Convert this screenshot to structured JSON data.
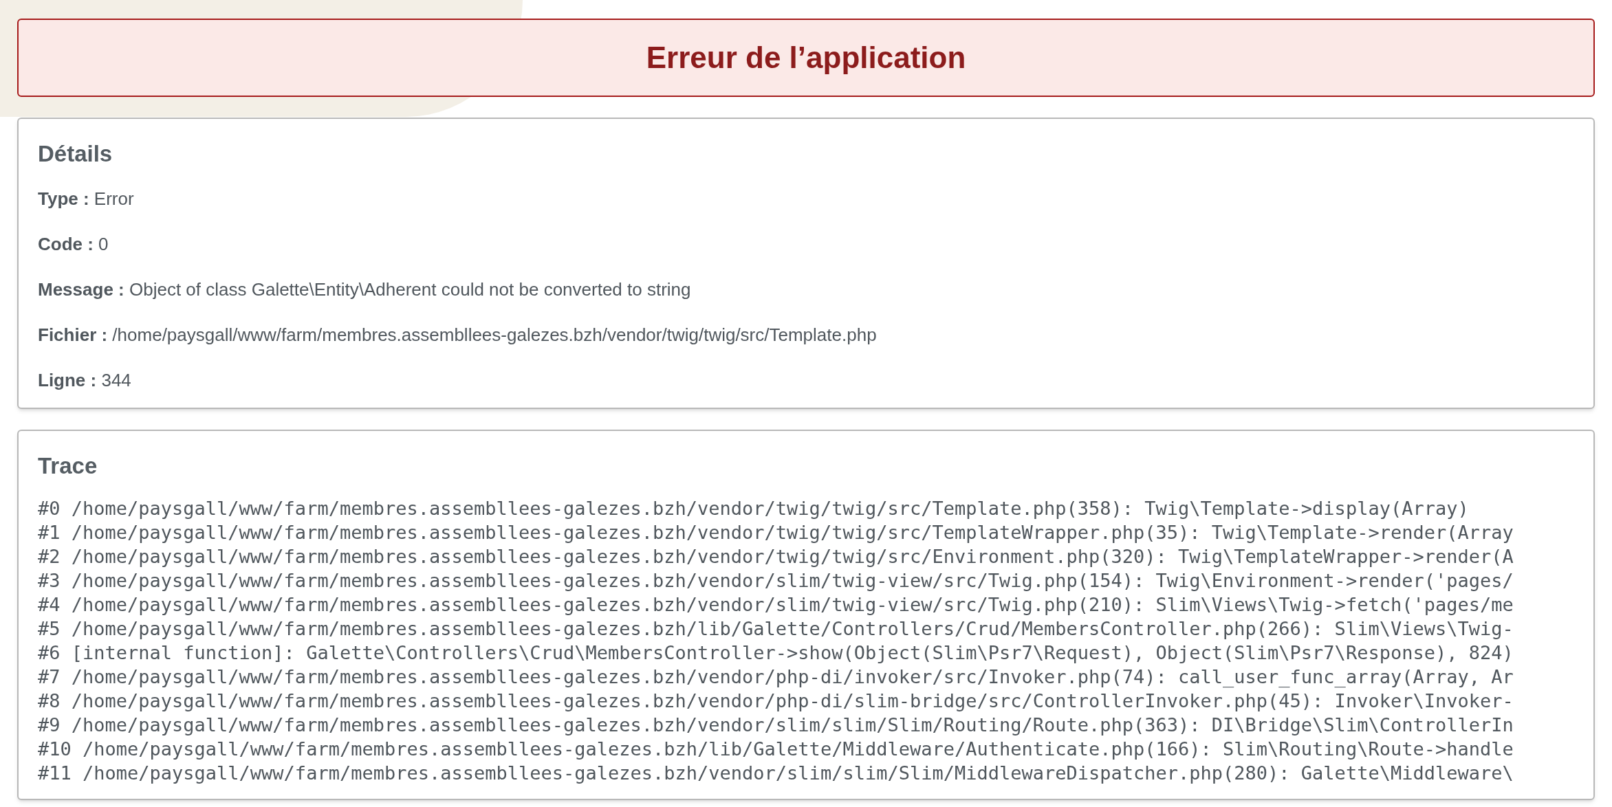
{
  "title": "Erreur de l’application",
  "details": {
    "heading": "Détails",
    "rows": [
      "**Type :** Error",
      "**Code :** 0",
      "**Message :** Object of class Galette\\Entity\\Adherent could not be converted to string",
      "**Fichier :** /home/paysgall/www/farm/membres.assembllees-galezes.bzh/vendor/twig/twig/src/Template.php",
      "**Ligne :** 344"
    ]
  },
  "trace": {
    "heading": "Trace",
    "lines": [
      "#0 /home/paysgall/www/farm/membres.assembllees-galezes.bzh/vendor/twig/twig/src/Template.php(358): Twig\\Template->display(Array)",
      "#1 /home/paysgall/www/farm/membres.assembllees-galezes.bzh/vendor/twig/twig/src/TemplateWrapper.php(35): Twig\\Template->render(Array",
      "#2 /home/paysgall/www/farm/membres.assembllees-galezes.bzh/vendor/twig/twig/src/Environment.php(320): Twig\\TemplateWrapper->render(A",
      "#3 /home/paysgall/www/farm/membres.assembllees-galezes.bzh/vendor/slim/twig-view/src/Twig.php(154): Twig\\Environment->render('pages/",
      "#4 /home/paysgall/www/farm/membres.assembllees-galezes.bzh/vendor/slim/twig-view/src/Twig.php(210): Slim\\Views\\Twig->fetch('pages/me",
      "#5 /home/paysgall/www/farm/membres.assembllees-galezes.bzh/lib/Galette/Controllers/Crud/MembersController.php(266): Slim\\Views\\Twig-",
      "#6 [internal function]: Galette\\Controllers\\Crud\\MembersController->show(Object(Slim\\Psr7\\Request), Object(Slim\\Psr7\\Response), 824)",
      "#7 /home/paysgall/www/farm/membres.assembllees-galezes.bzh/vendor/php-di/invoker/src/Invoker.php(74): call_user_func_array(Array, Ar",
      "#8 /home/paysgall/www/farm/membres.assembllees-galezes.bzh/vendor/php-di/slim-bridge/src/ControllerInvoker.php(45): Invoker\\Invoker-",
      "#9 /home/paysgall/www/farm/membres.assembllees-galezes.bzh/vendor/slim/slim/Slim/Routing/Route.php(363): DI\\Bridge\\Slim\\ControllerIn",
      "#10 /home/paysgall/www/farm/membres.assembllees-galezes.bzh/lib/Galette/Middleware/Authenticate.php(166): Slim\\Routing\\Route->handle",
      "#11 /home/paysgall/www/farm/membres.assembllees-galezes.bzh/vendor/slim/slim/Slim/MiddlewareDispatcher.php(280): Galette\\Middleware\\"
    ]
  }
}
